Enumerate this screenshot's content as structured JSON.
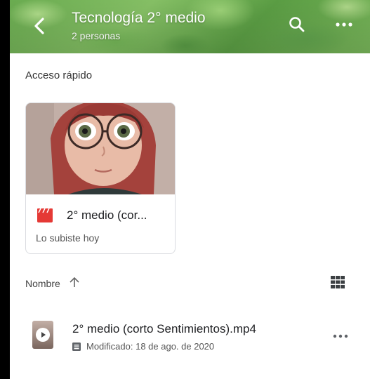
{
  "header": {
    "title": "Tecnología 2° medio",
    "subtitle": "2 personas"
  },
  "quick_access": {
    "label": "Acceso rápido",
    "card": {
      "title": "2° medio (cor...",
      "subtitle": "Lo subiste hoy",
      "file_icon": "video-clapper-icon"
    }
  },
  "sort": {
    "label": "Nombre",
    "direction_icon": "arrow-up-icon"
  },
  "files": [
    {
      "name": "2° medio (corto Sentimientos).mp4",
      "meta": "Modificado: 18 de ago. de 2020",
      "thumb_icon": "play-icon"
    }
  ],
  "colors": {
    "header_green": "#6fb454",
    "video_icon_red": "#e53935",
    "text_primary": "#202124",
    "text_secondary": "#555555"
  }
}
